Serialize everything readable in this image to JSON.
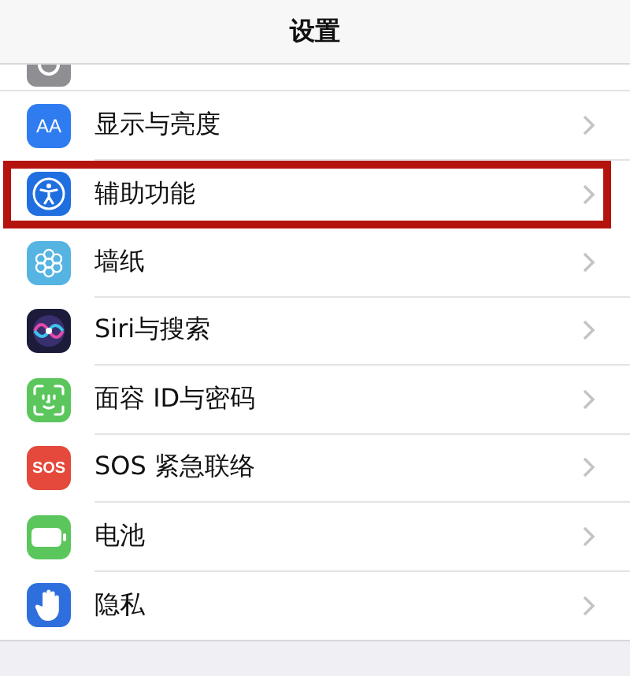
{
  "navigation_bar": {
    "title": "设置"
  },
  "rows": [
    {
      "kind": "display",
      "icon_text": "AA",
      "label": "显示与亮度",
      "highlighted": false
    },
    {
      "kind": "accessibility",
      "label": "辅助功能",
      "highlighted": true
    },
    {
      "kind": "wallpaper",
      "label": "墙纸",
      "highlighted": false
    },
    {
      "kind": "siri",
      "label": "Siri与搜索",
      "highlighted": false
    },
    {
      "kind": "faceid",
      "label": "面容 ID与密码",
      "highlighted": false
    },
    {
      "kind": "sos",
      "icon_text": "SOS",
      "label": "SOS 紧急联络",
      "highlighted": false
    },
    {
      "kind": "battery",
      "label": "电池",
      "highlighted": false
    },
    {
      "kind": "privacy",
      "label": "隐私",
      "highlighted": false
    }
  ]
}
